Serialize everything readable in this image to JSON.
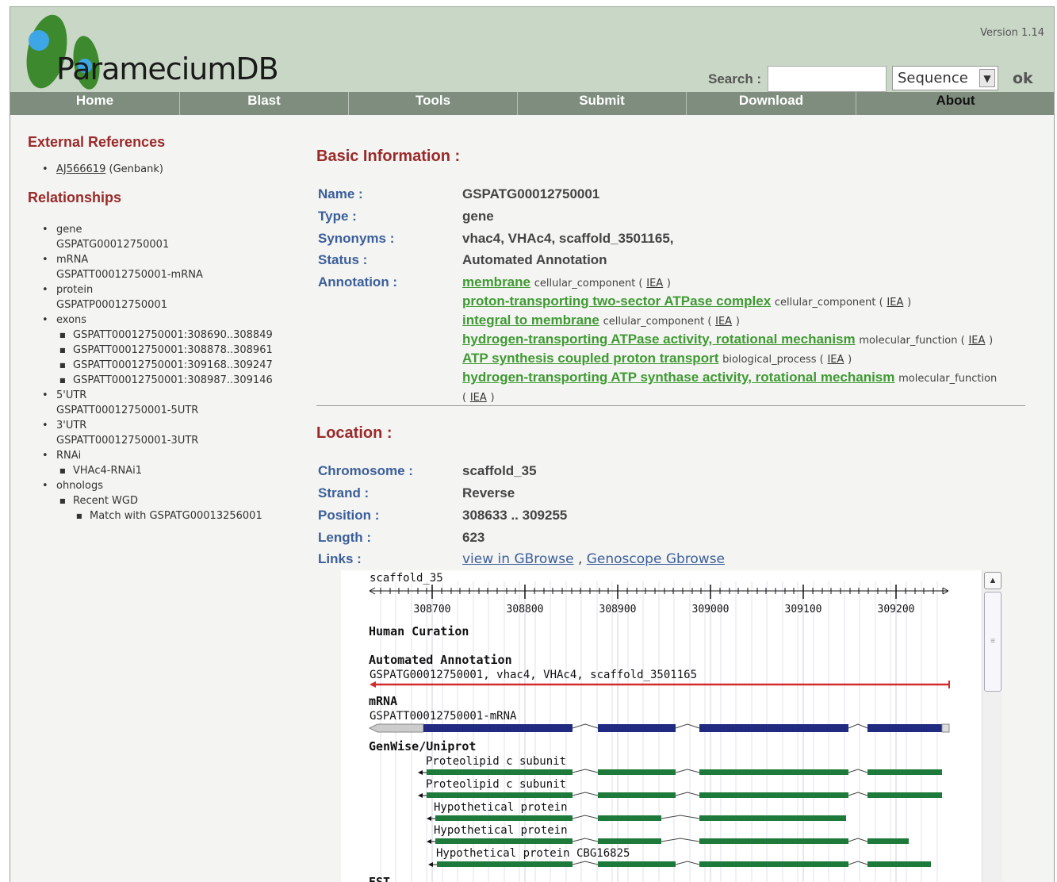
{
  "header": {
    "site_name": "ParameciumDB",
    "version": "Version 1.14",
    "search_label": "Search :",
    "search_value": "",
    "search_type": "Sequence",
    "ok_label": "ok"
  },
  "nav": [
    "Home",
    "Blast",
    "Tools",
    "Submit",
    "Download",
    "About"
  ],
  "sidebar": {
    "ext_heading": "External References",
    "ext_ref_link": "AJ566619",
    "ext_ref_source": "(Genbank)",
    "rel_heading": "Relationships",
    "gene_label": "gene",
    "gene_value": "GSPATG00012750001",
    "mrna_label": "mRNA",
    "mrna_value": "GSPATT00012750001-mRNA",
    "protein_label": "protein",
    "protein_value": "GSPATP00012750001",
    "exons_label": "exons",
    "exons": [
      "GSPATT00012750001:308690..308849",
      "GSPATT00012750001:308878..308961",
      "GSPATT00012750001:309168..309247",
      "GSPATT00012750001:308987..309146"
    ],
    "utr5_label": "5'UTR",
    "utr5_value": "GSPATT00012750001-5UTR",
    "utr3_label": "3'UTR",
    "utr3_value": "GSPATT00012750001-3UTR",
    "rnai_label": "RNAi",
    "rnai_value": "VHAc4-RNAi1",
    "ohnologs_label": "ohnologs",
    "recent_wgd": "Recent WGD",
    "match": "Match with GSPATG00013256001"
  },
  "basic": {
    "title": "Basic Information :",
    "name_label": "Name :",
    "name_value": "GSPATG00012750001",
    "type_label": "Type :",
    "type_value": "gene",
    "synonyms_label": "Synonyms :",
    "synonyms_value": "vhac4, VHAc4, scaffold_3501165,",
    "status_label": "Status :",
    "status_value": "Automated Annotation",
    "annotation_label": "Annotation :",
    "annotations": [
      {
        "term": "membrane",
        "category": "cellular_component (",
        "evidence": "IEA",
        "close": ")"
      },
      {
        "term": "proton-transporting two-sector ATPase complex",
        "category": "cellular_component (",
        "evidence": "IEA",
        "close": ")"
      },
      {
        "term": "integral to membrane",
        "category": "cellular_component (",
        "evidence": "IEA",
        "close": ")"
      },
      {
        "term": "hydrogen-transporting ATPase activity, rotational mechanism",
        "category": "molecular_function (",
        "evidence": "IEA",
        "close": ")"
      },
      {
        "term": "ATP synthesis coupled proton transport",
        "category": "biological_process (",
        "evidence": "IEA",
        "close": ")"
      },
      {
        "term": "hydrogen-transporting ATP synthase activity, rotational mechanism",
        "category": "molecular_function",
        "evidence": "",
        "close": ""
      }
    ],
    "last_open": "(",
    "last_evidence": "IEA",
    "last_close": ")"
  },
  "location": {
    "title": "Location :",
    "chromosome_label": "Chromosome :",
    "chromosome_value": "scaffold_35",
    "strand_label": "Strand :",
    "strand_value": "Reverse",
    "position_label": "Position :",
    "position_value": "308633 .. 309255",
    "length_label": "Length :",
    "length_value": "623",
    "links_label": "Links :",
    "link1": "view in GBrowse",
    "link_sep": ",",
    "link2": "Genoscope Gbrowse"
  },
  "gbrowse": {
    "scaffold": "scaffold_35",
    "ticks": [
      "308700",
      "308800",
      "308900",
      "309000",
      "309100",
      "309200"
    ],
    "track_human": "Human Curation",
    "track_auto": "Automated Annotation",
    "auto_label": "GSPATG00012750001, vhac4, VHAc4, scaffold_3501165",
    "track_mrna": "mRNA",
    "mrna_label": "GSPATT00012750001-mRNA",
    "track_genewise": "GenWise/Uniprot",
    "genewise": [
      "Proteolipid c subunit",
      "Proteolipid c subunit",
      "Hypothetical protein",
      "Hypothetical protein",
      "Hypothetical protein CBG16825"
    ],
    "track_est": "EST",
    "colors": {
      "auto": "#d22b2b",
      "mrna": "#1f2a80",
      "genewise": "#1e7a3a",
      "utr": "#cccccc"
    }
  }
}
